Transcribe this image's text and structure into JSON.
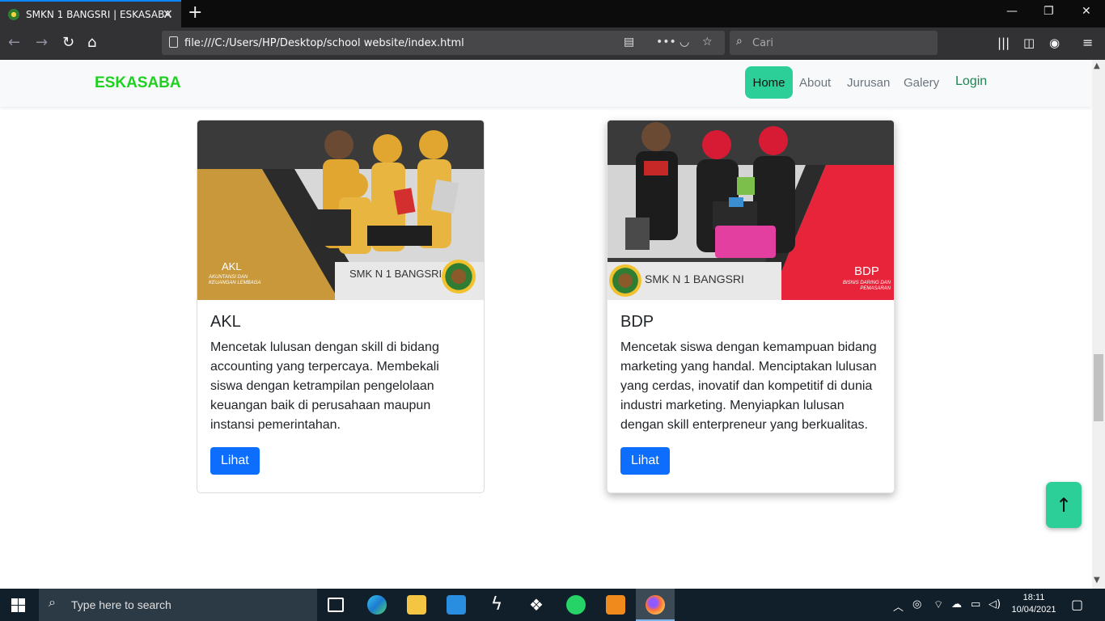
{
  "browser": {
    "tab_title": "SMKN 1 BANGSRI | ESKASABA",
    "url": "file:///C:/Users/HP/Desktop/school website/index.html",
    "search_placeholder": "Cari"
  },
  "site": {
    "brand": "ESKASABA",
    "nav": {
      "home": "Home",
      "about": "About",
      "jurusan": "Jurusan",
      "galery": "Galery",
      "login": "Login"
    },
    "cards": [
      {
        "title": "AKL",
        "text": "Mencetak lulusan dengan skill di bidang accounting yang terpercaya. Membekali siswa dengan ketrampilan pengelolaan keuangan baik di perusahaan maupun instansi pemerintahan.",
        "button": "Lihat",
        "banner_code": "AKL",
        "banner_sub": "AKUNTANSI DAN KEUANGAN LEMBAGA",
        "banner_school": "SMK N 1 BANGSRI",
        "accent": "#c8983a"
      },
      {
        "title": "BDP",
        "text": "Mencetak siswa dengan kemampuan bidang marketing yang handal. Menciptakan lulusan yang cerdas, inovatif dan kompetitif di dunia industri marketing. Menyiapkan lulusan dengan skill enterpreneur yang berkualitas.",
        "button": "Lihat",
        "banner_code": "BDP",
        "banner_sub": "BISNIS DARING DAN PEMASARAN",
        "banner_school": "SMK N 1 BANGSRI",
        "accent": "#e8243a"
      }
    ],
    "back_to_top": "↑"
  },
  "taskbar": {
    "search_placeholder": "Type here to search",
    "time": "18:11",
    "date": "10/04/2021"
  }
}
